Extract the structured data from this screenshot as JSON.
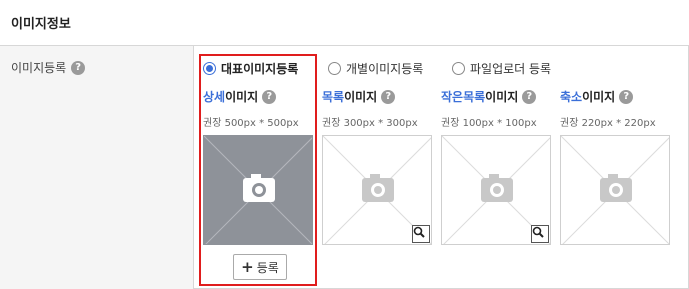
{
  "section": {
    "title": "이미지정보"
  },
  "image_registration": {
    "label": "이미지등록",
    "help_glyph": "?",
    "modes": [
      {
        "label": "대표이미지등록",
        "selected": true
      },
      {
        "label": "개별이미지등록",
        "selected": false
      },
      {
        "label": "파일업로더 등록",
        "selected": false
      }
    ],
    "columns": [
      {
        "title_accent": "상세",
        "title_rest": "이미지",
        "recommend": "권장 500px * 500px",
        "state": "filled"
      },
      {
        "title_accent": "목록",
        "title_rest": "이미지",
        "recommend": "권장 300px * 300px",
        "state": "empty"
      },
      {
        "title_accent": "작은목록",
        "title_rest": "이미지",
        "recommend": "권장 100px * 100px",
        "state": "empty"
      },
      {
        "title_accent": "축소",
        "title_rest": "이미지",
        "recommend": "권장 220px * 220px",
        "state": "empty"
      }
    ],
    "register_button": {
      "icon": "+",
      "label": "등록"
    }
  },
  "colors": {
    "accent": "#3b6fd8",
    "highlight_border": "#e01d1d",
    "filled_thumb": "#8e9299"
  },
  "icons": [
    "help-icon",
    "camera-icon",
    "magnifier-icon",
    "plus-icon"
  ]
}
